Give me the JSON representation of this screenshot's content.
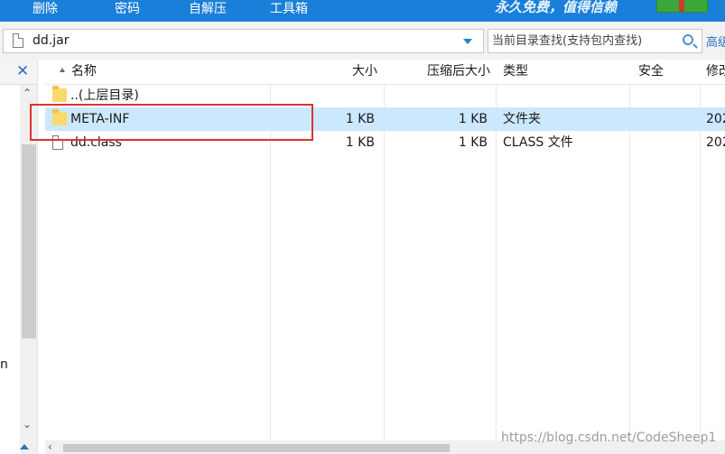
{
  "toolbar": {
    "buttons": [
      {
        "label": "删除"
      },
      {
        "label": "密码"
      },
      {
        "label": "自解压"
      },
      {
        "label": "工具箱"
      }
    ],
    "slogan": "永久免费，值得信赖",
    "background_color": "#1a7fd8"
  },
  "address": {
    "path": "dd.jar",
    "dropdown_icon": "chevron-down-icon"
  },
  "search": {
    "placeholder": "当前目录查找(支持包内查找)",
    "advanced_label": "高级"
  },
  "columns": [
    {
      "label": "名称",
      "sort": "ascending"
    },
    {
      "label": "大小"
    },
    {
      "label": "压缩后大小"
    },
    {
      "label": "类型"
    },
    {
      "label": "安全"
    },
    {
      "label": "修改"
    }
  ],
  "rows": [
    {
      "name": "..(上层目录)",
      "size": "",
      "packed": "",
      "type": "",
      "safety": "",
      "modified": "",
      "icon": "folder-icon"
    },
    {
      "name": "META-INF",
      "size": "1 KB",
      "packed": "1 KB",
      "type": "文件夹",
      "safety": "",
      "modified": "202",
      "icon": "folder-icon",
      "selected": true
    },
    {
      "name": "dd.class",
      "size": "1 KB",
      "packed": "1 KB",
      "type": "CLASS 文件",
      "safety": "",
      "modified": "202",
      "icon": "file-icon"
    }
  ],
  "tree": {
    "partial_text": "n"
  },
  "watermark": "https://blog.csdn.net/CodeSheep1",
  "colors": {
    "selection": "#cce8ff",
    "annotation": "#e03232",
    "accent": "#1a7fd8"
  }
}
